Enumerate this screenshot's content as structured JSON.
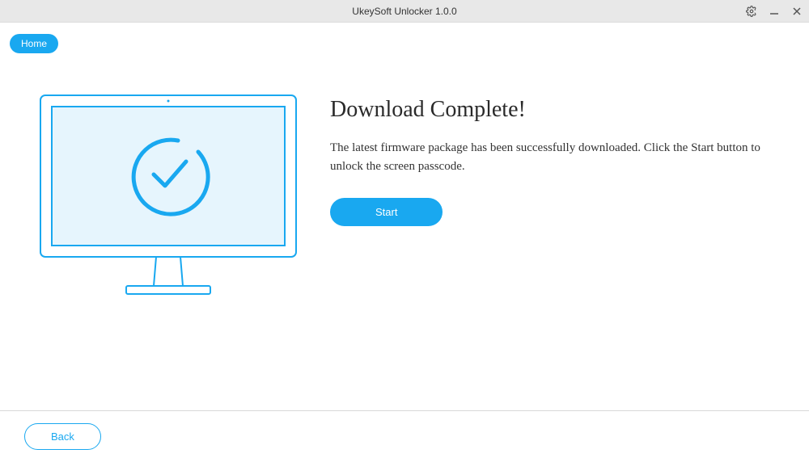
{
  "titlebar": {
    "title": "UkeySoft Unlocker 1.0.0"
  },
  "nav": {
    "home_label": "Home"
  },
  "main": {
    "heading": "Download Complete!",
    "description": "The latest firmware package has been successfully downloaded. Click the Start button to unlock the screen passcode.",
    "start_label": "Start"
  },
  "footer": {
    "back_label": "Back"
  },
  "colors": {
    "accent": "#19a8f0",
    "illustration_stroke": "#19a8f0",
    "illustration_fill": "#e6f5fd"
  }
}
